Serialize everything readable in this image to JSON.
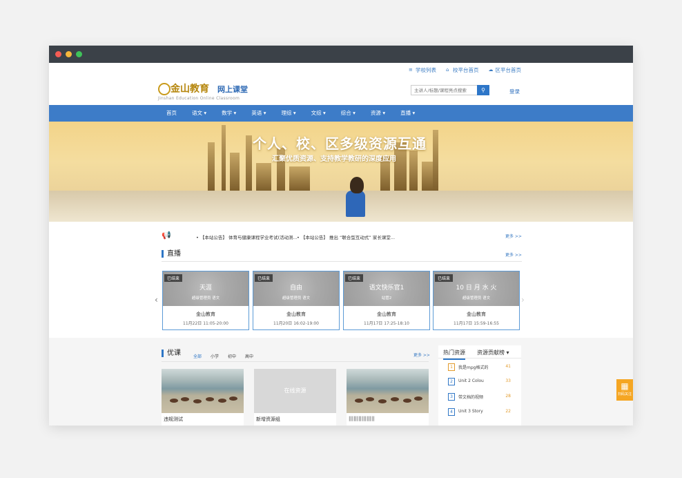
{
  "toplinks": [
    "学校列表",
    "校平台首页",
    "区平台首页"
  ],
  "logo": {
    "title": "金山教育",
    "subtitle": "网上课堂",
    "english": "Jinshan Education Online Classroom"
  },
  "search": {
    "placeholder": "主讲人/标题/课程亮点搜索"
  },
  "login": "登录",
  "nav": [
    "首页",
    "语文",
    "数学",
    "英语",
    "理综",
    "文综",
    "综合",
    "资源",
    "直播"
  ],
  "banner": {
    "headline": "个人、校、区多级资源互通",
    "sub": "汇聚优质资源、支持教学教研的深度应用"
  },
  "notices": [
    "• 【本站公告】 体育与健康课程学业考试(活动测...",
    "• 【本站公告】 推出 “联合型互动式” 家长课堂..."
  ],
  "more": "更多 >>",
  "live": {
    "title": "直播",
    "cards": [
      {
        "badge": "已结束",
        "title": "天涯",
        "tag": "超级管理员      语文",
        "name": "金山教育",
        "time": "11月22日 11:05-20:00"
      },
      {
        "badge": "已结束",
        "title": "自由",
        "tag": "超级管理员      语文",
        "name": "金山教育",
        "time": "11月20日 16:02-19:00"
      },
      {
        "badge": "已结束",
        "title": "语文快乐官1",
        "tag": "站管2",
        "name": "金山教育",
        "time": "11月17日 17:25-18:10"
      },
      {
        "badge": "已结束",
        "title": "10  日  月  水  火",
        "tag": "超级管理员      语文",
        "name": "金山教育",
        "time": "11月17日 15:59-16:55"
      }
    ]
  },
  "course": {
    "title": "优课",
    "tabs": [
      "全部",
      "小学",
      "初中",
      "高中"
    ],
    "items": [
      {
        "title": "违规测试"
      },
      {
        "title": "在线资源",
        "sub": "新增资源组"
      },
      {
        "title": "||||||||||||||||"
      }
    ]
  },
  "side": {
    "tabs": [
      "热门资源",
      "资源贡献榜"
    ],
    "ranks": [
      {
        "no": "1",
        "name": "我是mpg格式的",
        "val": "41"
      },
      {
        "no": "2",
        "name": "Unit      2   Colou",
        "val": "33"
      },
      {
        "no": "3",
        "name": "带文档的视频",
        "val": "28"
      },
      {
        "no": "4",
        "name": "Unit      3   Story",
        "val": "22"
      }
    ]
  },
  "float": "扫码关注",
  "colors": {
    "brand": "#3d7cc8",
    "accent": "#e29a2a"
  }
}
